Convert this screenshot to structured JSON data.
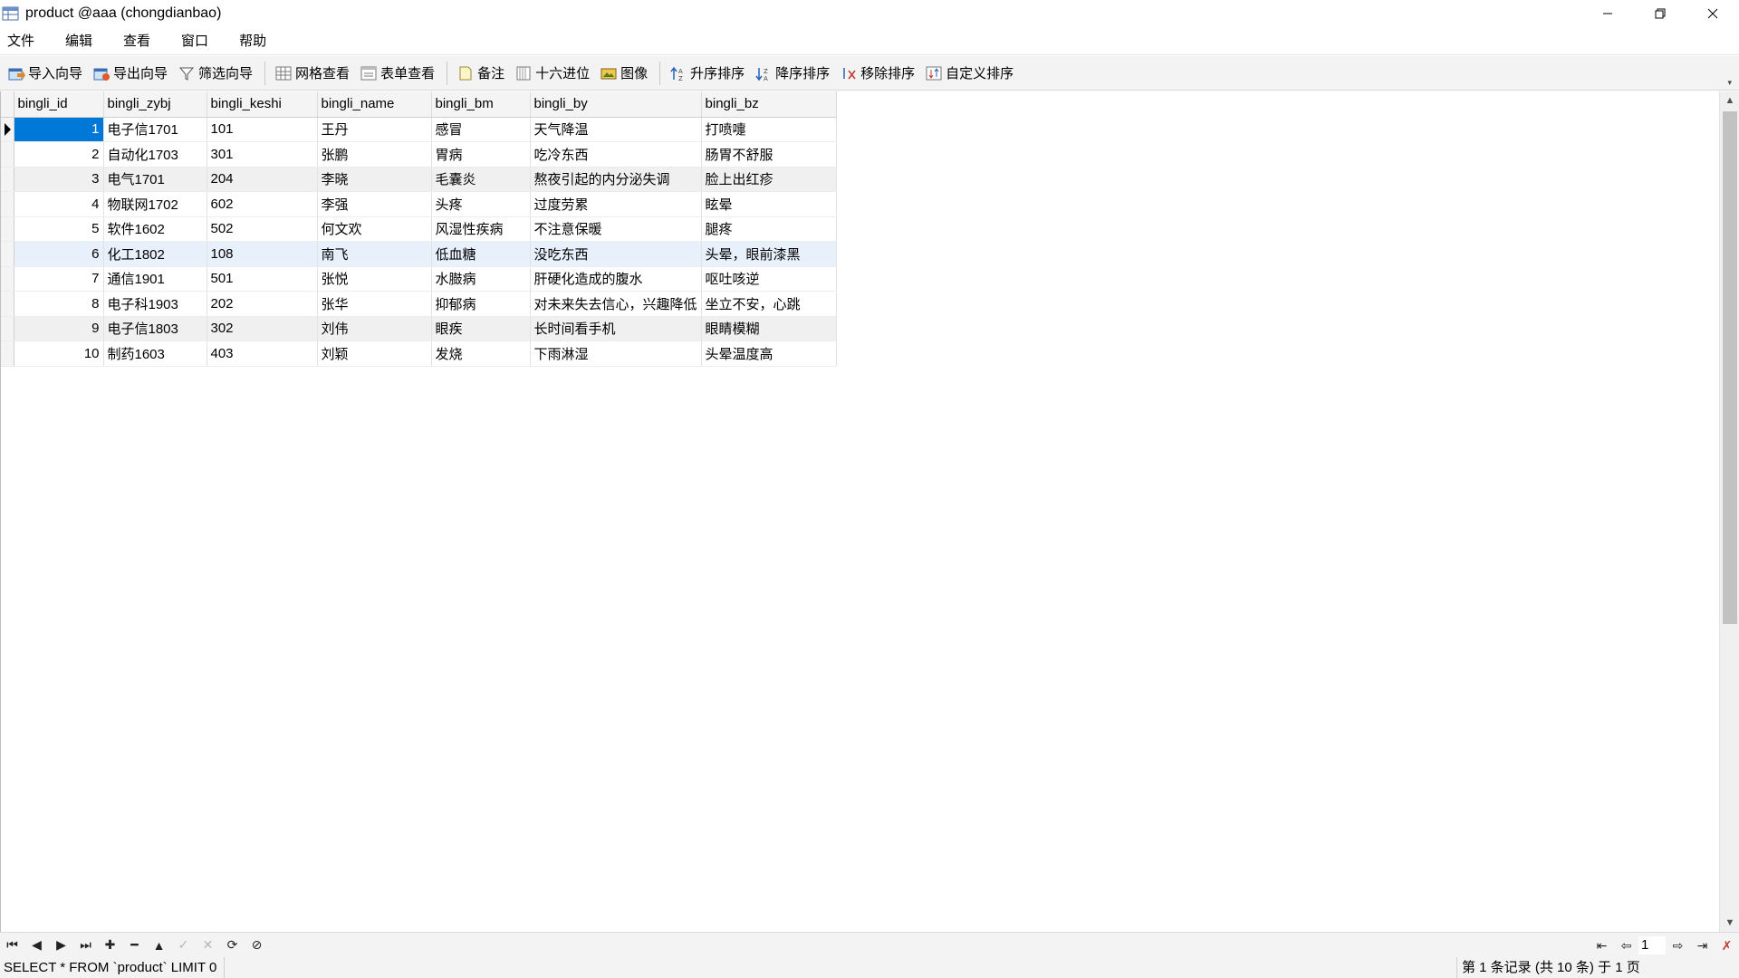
{
  "window": {
    "title": "product @aaa (chongdianbao)"
  },
  "menu": {
    "items": [
      "文件",
      "编辑",
      "查看",
      "窗口",
      "帮助"
    ]
  },
  "toolbar": {
    "import_label": "导入向导",
    "export_label": "导出向导",
    "filter_label": "筛选向导",
    "grid_view_label": "网格查看",
    "form_view_label": "表单查看",
    "memo_label": "备注",
    "hex_label": "十六进位",
    "image_label": "图像",
    "sort_asc_label": "升序排序",
    "sort_desc_label": "降序排序",
    "remove_sort_label": "移除排序",
    "custom_sort_label": "自定义排序"
  },
  "grid": {
    "columns": [
      "bingli_id",
      "bingli_zybj",
      "bingli_keshi",
      "bingli_name",
      "bingli_bm",
      "bingli_by",
      "bingli_bz"
    ],
    "rows": [
      [
        "1",
        "电子信1701",
        "101",
        "王丹",
        "感冒",
        "天气降温",
        "打喷嚏"
      ],
      [
        "2",
        "自动化1703",
        "301",
        "张鹏",
        "胃病",
        "吃冷东西",
        "肠胃不舒服"
      ],
      [
        "3",
        "电气1701",
        "204",
        "李晓",
        "毛囊炎",
        "熬夜引起的内分泌失调",
        "脸上出红疹"
      ],
      [
        "4",
        "物联网1702",
        "602",
        "李强",
        "头疼",
        "过度劳累",
        "眩晕"
      ],
      [
        "5",
        "软件1602",
        "502",
        "何文欢",
        "风湿性疾病",
        "不注意保暖",
        "腿疼"
      ],
      [
        "6",
        "化工1802",
        "108",
        "南飞",
        "低血糖",
        "没吃东西",
        "头晕，眼前漆黑"
      ],
      [
        "7",
        "通信1901",
        "501",
        "张悦",
        "水臌病",
        "肝硬化造成的腹水",
        "呕吐咳逆"
      ],
      [
        "8",
        "电子科1903",
        "202",
        "张华",
        "抑郁病",
        "对未来失去信心，兴趣降低",
        "坐立不安，心跳"
      ],
      [
        "9",
        "电子信1803",
        "302",
        "刘伟",
        "眼疾",
        "长时间看手机",
        "眼睛模糊"
      ],
      [
        "10",
        "制药1603",
        "403",
        "刘颖",
        "发烧",
        "下雨淋湿",
        "头晕温度高"
      ]
    ]
  },
  "pager": {
    "page": "1"
  },
  "status": {
    "sql": "SELECT * FROM `product` LIMIT 0",
    "record_info": "第 1 条记录 (共 10 条) 于 1 页"
  }
}
